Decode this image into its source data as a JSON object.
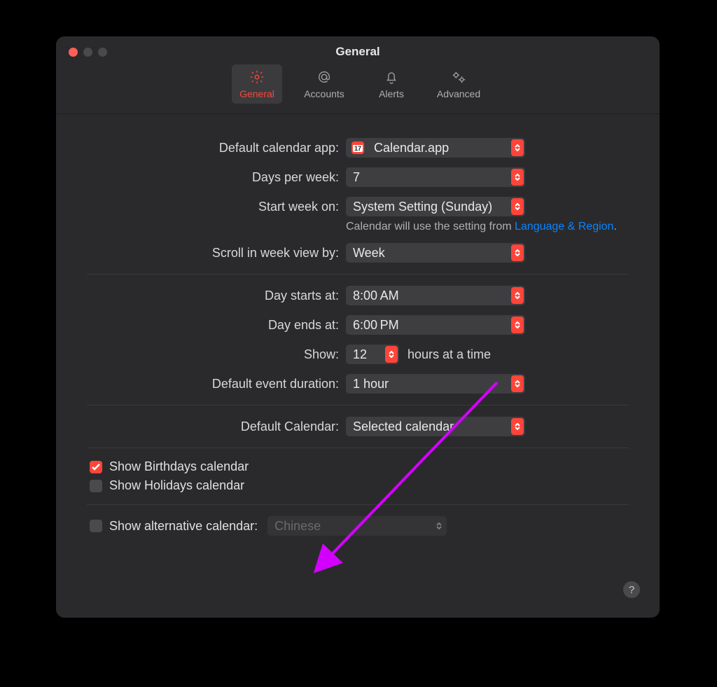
{
  "window": {
    "title": "General"
  },
  "toolbar": {
    "items": [
      {
        "label": "General"
      },
      {
        "label": "Accounts"
      },
      {
        "label": "Alerts"
      },
      {
        "label": "Advanced"
      }
    ]
  },
  "settings": {
    "default_app_label": "Default calendar app:",
    "default_app_value": "Calendar.app",
    "app_icon_day": "17",
    "days_per_week_label": "Days per week:",
    "days_per_week_value": "7",
    "start_week_label": "Start week on:",
    "start_week_value": "System Setting (Sunday)",
    "start_week_hint_prefix": "Calendar will use the setting from ",
    "start_week_hint_link": "Language & Region",
    "scroll_week_label": "Scroll in week view by:",
    "scroll_week_value": "Week",
    "day_starts_label": "Day starts at:",
    "day_starts_value": "8:00 AM",
    "day_ends_label": "Day ends at:",
    "day_ends_value": "6:00 PM",
    "show_label": "Show:",
    "show_value": "12",
    "show_suffix": "hours at a time",
    "event_duration_label": "Default event duration:",
    "event_duration_value": "1 hour",
    "default_calendar_label": "Default Calendar:",
    "default_calendar_value": "Selected calendar",
    "show_birthdays_label": "Show Birthdays calendar",
    "show_holidays_label": "Show Holidays calendar",
    "show_alt_label": "Show alternative calendar:",
    "alt_calendar_value": "Chinese"
  },
  "help_glyph": "?"
}
